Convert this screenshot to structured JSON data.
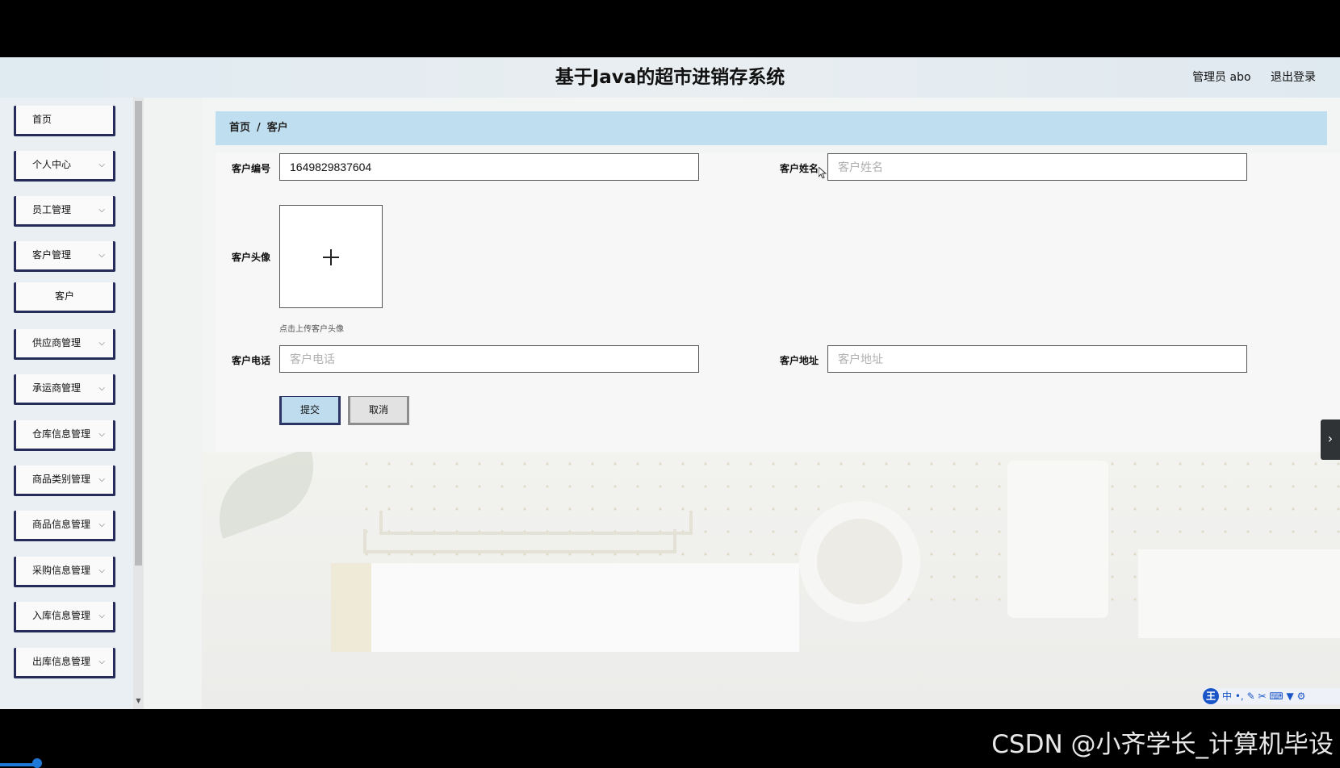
{
  "header": {
    "title": "基于Java的超市进销存系统",
    "admin_label": "管理员 abo",
    "logout_label": "退出登录"
  },
  "sidebar": {
    "items": [
      {
        "label": "首页",
        "has_arrow": false
      },
      {
        "label": "个人中心",
        "has_arrow": true
      },
      {
        "label": "员工管理",
        "has_arrow": true
      },
      {
        "label": "客户管理",
        "has_arrow": true
      },
      {
        "label": "客户",
        "has_arrow": false,
        "sub": true
      },
      {
        "label": "供应商管理",
        "has_arrow": true
      },
      {
        "label": "承运商管理",
        "has_arrow": true
      },
      {
        "label": "仓库信息管理",
        "has_arrow": true
      },
      {
        "label": "商品类别管理",
        "has_arrow": true
      },
      {
        "label": "商品信息管理",
        "has_arrow": true
      },
      {
        "label": "采购信息管理",
        "has_arrow": true
      },
      {
        "label": "入库信息管理",
        "has_arrow": true
      },
      {
        "label": "出库信息管理",
        "has_arrow": true
      }
    ]
  },
  "breadcrumb": {
    "home": "首页",
    "separator": "/",
    "current": "客户"
  },
  "form": {
    "customer_id_label": "客户编号",
    "customer_id_value": "1649829837604",
    "customer_name_label": "客户姓名",
    "customer_name_placeholder": "客户姓名",
    "avatar_label": "客户头像",
    "avatar_hint": "点击上传客户头像",
    "phone_label": "客户电话",
    "phone_placeholder": "客户电话",
    "address_label": "客户地址",
    "address_placeholder": "客户地址",
    "submit_label": "提交",
    "cancel_label": "取消"
  },
  "ime": {
    "logo": "王",
    "mode": "中"
  },
  "watermark": "CSDN @小齐学长_计算机毕设",
  "colors": {
    "accent_dark": "#262c5a",
    "breadcrumb_bg": "#bfdeef",
    "submit_bg": "#bedcee"
  }
}
